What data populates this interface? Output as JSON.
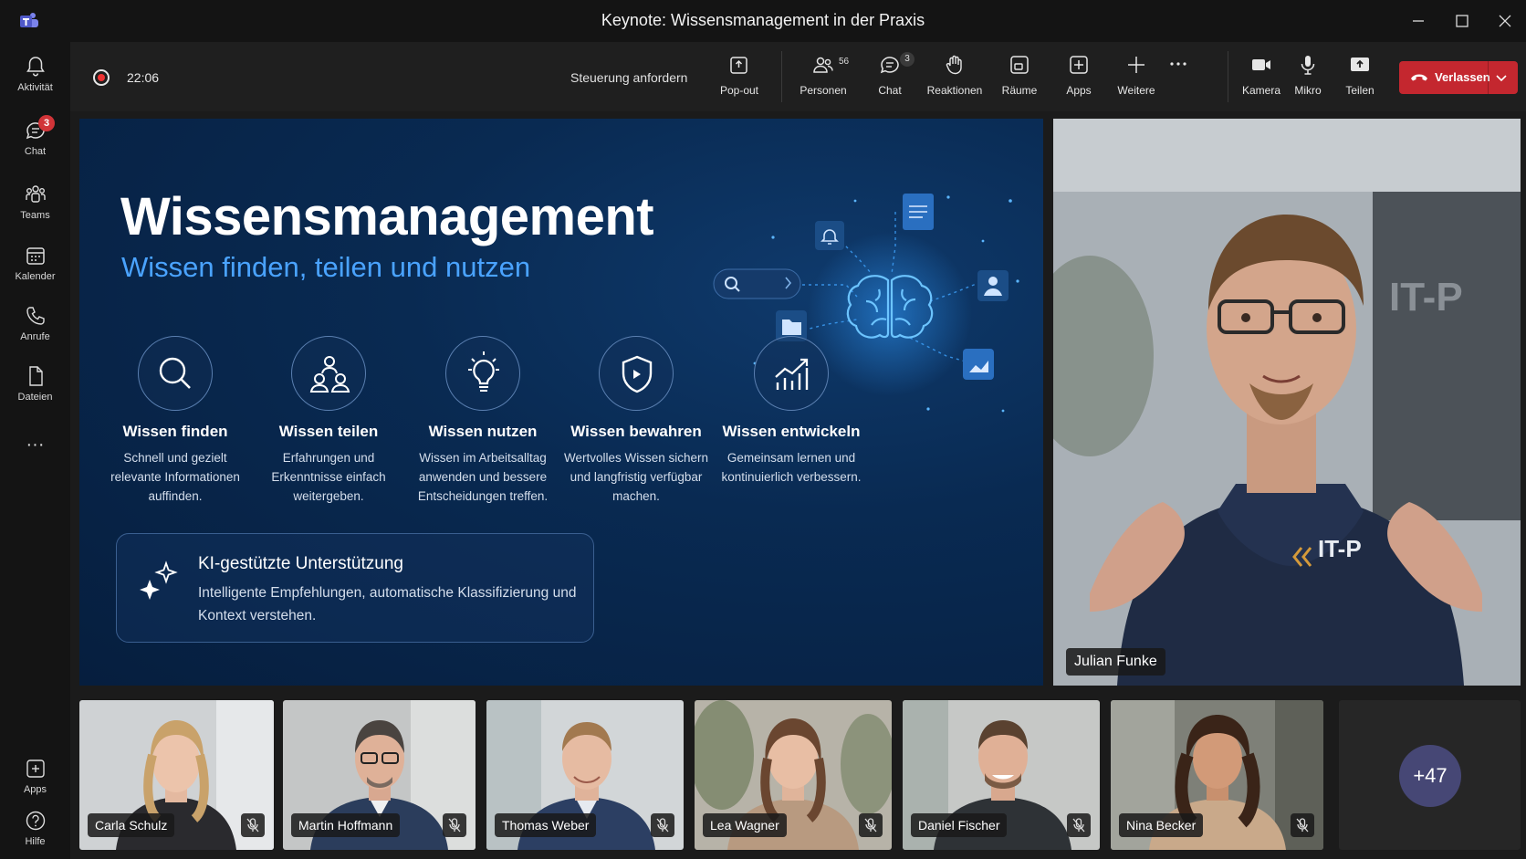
{
  "window": {
    "title": "Keynote: Wissensmanagement in der Praxis"
  },
  "rail": {
    "items": [
      {
        "label": "Aktivität",
        "icon": "bell-icon"
      },
      {
        "label": "Chat",
        "icon": "chat-icon",
        "badge": "3"
      },
      {
        "label": "Teams",
        "icon": "teams-icon"
      },
      {
        "label": "Kalender",
        "icon": "calendar-icon"
      },
      {
        "label": "Anrufe",
        "icon": "phone-icon"
      },
      {
        "label": "Dateien",
        "icon": "file-icon"
      }
    ],
    "more": "···",
    "bottom": [
      {
        "label": "Apps",
        "icon": "apps-icon"
      },
      {
        "label": "Hilfe",
        "icon": "help-icon"
      }
    ]
  },
  "toolbar": {
    "timer": "22:06",
    "request_control": "Steuerung anfordern",
    "popout": "Pop-out",
    "people": "Personen",
    "people_count": "56",
    "chat": "Chat",
    "chat_count": "3",
    "reactions": "Reaktionen",
    "rooms": "Räume",
    "apps": "Apps",
    "more_label": "Weitere",
    "camera": "Kamera",
    "mic": "Mikro",
    "share": "Teilen",
    "leave": "Verlassen"
  },
  "slide": {
    "title": "Wissensmanagement",
    "subtitle": "Wissen finden, teilen und nutzen",
    "pillars": [
      {
        "title": "Wissen finden",
        "desc": "Schnell und gezielt relevante Informationen auffinden.",
        "icon": "search-icon"
      },
      {
        "title": "Wissen teilen",
        "desc": "Erfahrungen und Erkenntnisse einfach weitergeben.",
        "icon": "people-share-icon"
      },
      {
        "title": "Wissen nutzen",
        "desc": "Wissen im Arbeitsalltag anwenden und bessere Entscheidungen treffen.",
        "icon": "lightbulb-icon"
      },
      {
        "title": "Wissen bewahren",
        "desc": "Wertvolles Wissen sichern und langfristig verfügbar machen.",
        "icon": "shield-icon"
      },
      {
        "title": "Wissen entwickeln",
        "desc": "Gemeinsam lernen und kontinuierlich verbessern.",
        "icon": "growth-chart-icon"
      }
    ],
    "ai": {
      "title": "KI-gestützte Unterstützung",
      "desc": "Intelligente Empfehlungen, automatische Klassifizierung und Kontext verstehen."
    }
  },
  "speaker": {
    "name": "Julian Funke",
    "shirt_logo": "IT-P",
    "wall_logo": "IT-P"
  },
  "participants": [
    {
      "name": "Carla Schulz"
    },
    {
      "name": "Martin Hoffmann"
    },
    {
      "name": "Thomas Weber"
    },
    {
      "name": "Lea Wagner"
    },
    {
      "name": "Daniel Fischer"
    },
    {
      "name": "Nina Becker"
    }
  ],
  "overflow": "+47",
  "colors": {
    "accent": "#4aa3ff",
    "leave": "#c4272f",
    "badge": "#d13438"
  }
}
